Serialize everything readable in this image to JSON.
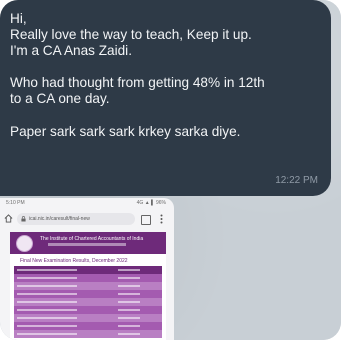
{
  "message": {
    "lines": [
      "Hi,",
      "Really love the way to teach, Keep it up.",
      "I'm a CA Anas Zaidi.",
      "",
      "Who had thought from getting 48% in 12th",
      "to a CA one day.",
      "",
      "Paper sark sark sark krkey sarka diye."
    ],
    "time": "12:22 PM"
  },
  "attachment": {
    "status_time": "5:10 PM",
    "status_right": "4G ▲ ▌ 96%",
    "url": "icai.nic.in/caresult/final-new",
    "institute_name": "The Institute of Chartered Accountants of India",
    "results_title": "Final New Examination Results, December 2022"
  },
  "colors": {
    "bubble": "#2e3a47",
    "text": "#f2f4f6",
    "time": "#8f9aa6",
    "icai_purple": "#6e2a7a"
  }
}
